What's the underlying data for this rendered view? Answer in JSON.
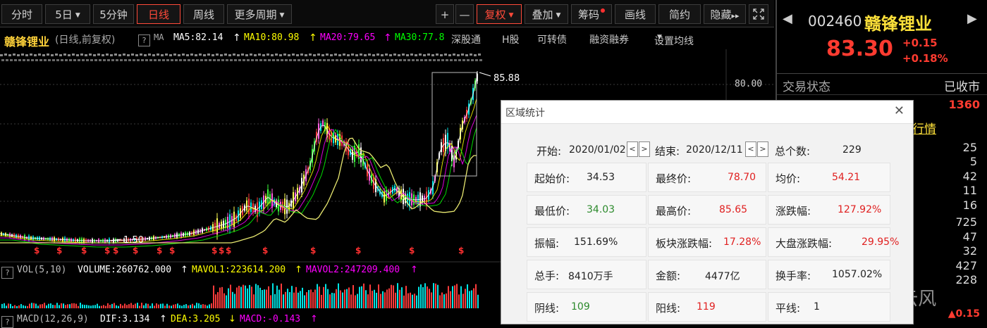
{
  "toolbar": {
    "tabs": [
      "分时",
      "5日",
      "5分钟",
      "日线",
      "周线",
      "更多周期"
    ],
    "plus": "+",
    "minus": "—",
    "fuquan": "复权",
    "diejia": "叠加",
    "chouma": "筹码",
    "huaxian": "画线",
    "jianyue": "简约",
    "yincang": "隐藏",
    "more_arrow": "▸▸"
  },
  "infobar": {
    "name": "赣锋锂业",
    "period": "(日线,前复权)",
    "ma_label": "MA",
    "ma5": "MA5:82.14",
    "ma10": "MA10:80.98",
    "ma20": "MA20:79.65",
    "ma30": "MA30:77.8",
    "links": [
      "深股通",
      "H股",
      "可转债",
      "融资融券",
      "设置均线"
    ],
    "colors": {
      "ma5": "#ffffff",
      "ma10": "#ffff00",
      "ma20": "#ff00ff",
      "ma30": "#00ff00"
    }
  },
  "chart": {
    "price_label": "80.00",
    "high_marker": "85.88",
    "low_marker": "1.50",
    "vol_line": {
      "label": "VOL(5,10)",
      "volume": "VOLUME:260762.000",
      "mavol1": "MAVOL1:223614.200",
      "mavol2": "MAVOL2:247209.400"
    },
    "macd_line": {
      "label": "MACD(12,26,9)",
      "dif": "DIF:3.134",
      "dea": "DEA:3.205",
      "macd": "MACD:-0.143"
    }
  },
  "right_panel": {
    "code": "002460",
    "name": "赣锋锂业",
    "price": "83.30",
    "change": "+0.15",
    "change_pct": "+0.18%",
    "status_label": "交易状态",
    "status_value": "已收市",
    "value_1360": "1360",
    "hangye": "行情",
    "values": [
      "25",
      "5",
      "42",
      "11",
      "16",
      "725",
      "47",
      "32",
      "427",
      "228"
    ],
    "bottom_value": "▲0.15",
    "watermark": "古月流云风"
  },
  "dialog": {
    "title": "区域统计",
    "close": "✕",
    "start_label": "开始:",
    "start_date": "2020/01/02",
    "end_label": "结束:",
    "end_date": "2020/12/11",
    "total_label": "总个数:",
    "total": "229",
    "spin_left": "<",
    "spin_right": ">",
    "cells": [
      {
        "label": "起始价:",
        "value": "34.53",
        "color": "blk"
      },
      {
        "label": "最终价:",
        "value": "78.70",
        "color": "red"
      },
      {
        "label": "均价:",
        "value": "54.21",
        "color": "red"
      },
      {
        "label": "最低价:",
        "value": "34.03",
        "color": "green"
      },
      {
        "label": "最高价:",
        "value": "85.65",
        "color": "red"
      },
      {
        "label": "涨跌幅:",
        "value": "127.92%",
        "color": "red"
      },
      {
        "label": "振幅:",
        "value": "151.69%",
        "color": "blk"
      },
      {
        "label": "板块涨跌幅:",
        "value": "17.28%",
        "color": "red"
      },
      {
        "label": "大盘涨跌幅:",
        "value": "29.95%",
        "color": "red"
      },
      {
        "label": "总手:",
        "value": "8410万手",
        "color": "blk"
      },
      {
        "label": "金额:",
        "value": "4477亿",
        "color": "blk"
      },
      {
        "label": "换手率:",
        "value": "1057.02%",
        "color": "blk"
      },
      {
        "label": "阴线:",
        "value": "109",
        "color": "green"
      },
      {
        "label": "阳线:",
        "value": "119",
        "color": "red"
      },
      {
        "label": "平线:",
        "value": "1",
        "color": "blk"
      }
    ]
  }
}
